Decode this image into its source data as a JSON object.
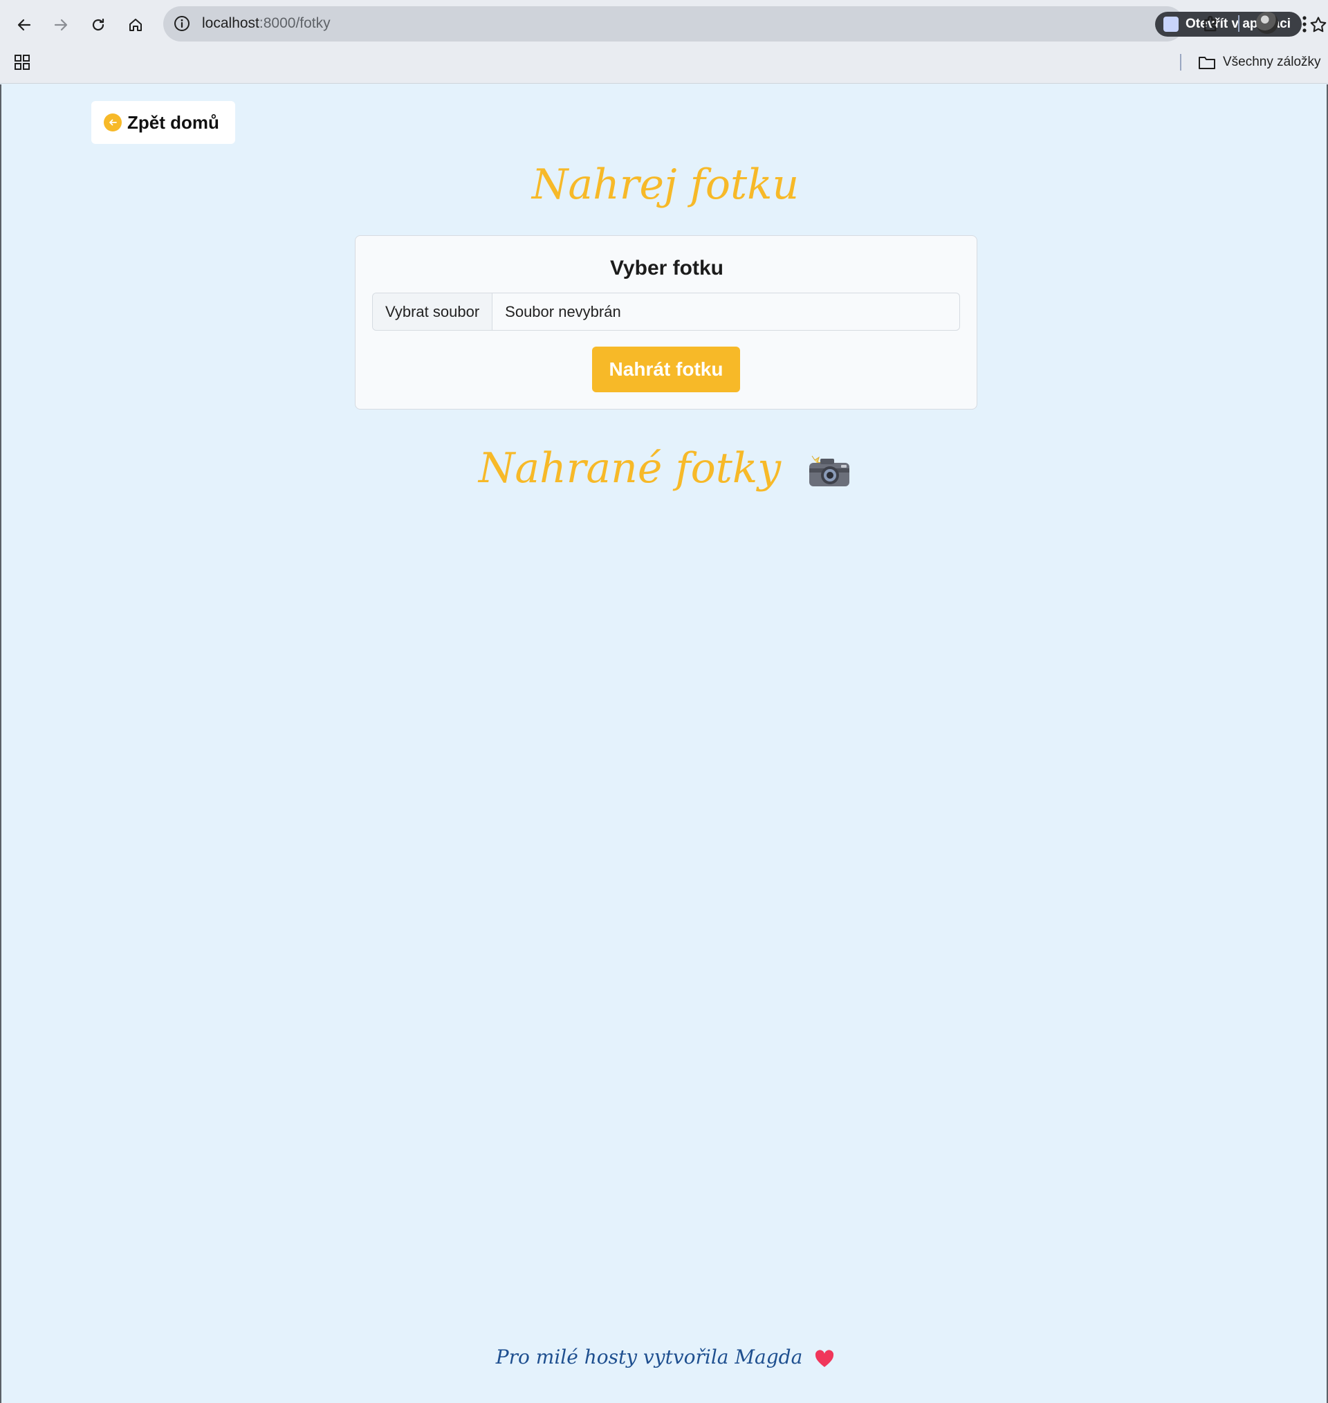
{
  "browser": {
    "url_host": "localhost",
    "url_path": ":8000/fotky",
    "open_in_app": "Otevřít v aplikaci",
    "all_bookmarks": "Všechny záložky"
  },
  "page": {
    "back_button": "Zpět domů",
    "upload_heading": "Nahrej fotku",
    "card_title": "Vyber fotku",
    "file_choose_label": "Vybrat soubor",
    "file_status": "Soubor nevybrán",
    "upload_button": "Nahrát fotku",
    "uploaded_heading": "Nahrané fotky",
    "footer_text": "Pro milé hosty vytvořila Magda"
  },
  "colors": {
    "accent": "#f7b928",
    "page_background": "#e4f2fc",
    "footer_text": "#1e4f8f"
  },
  "icons": {
    "heading_emoji": "camera-with-flash-icon",
    "footer_emoji": "heart-icon"
  }
}
